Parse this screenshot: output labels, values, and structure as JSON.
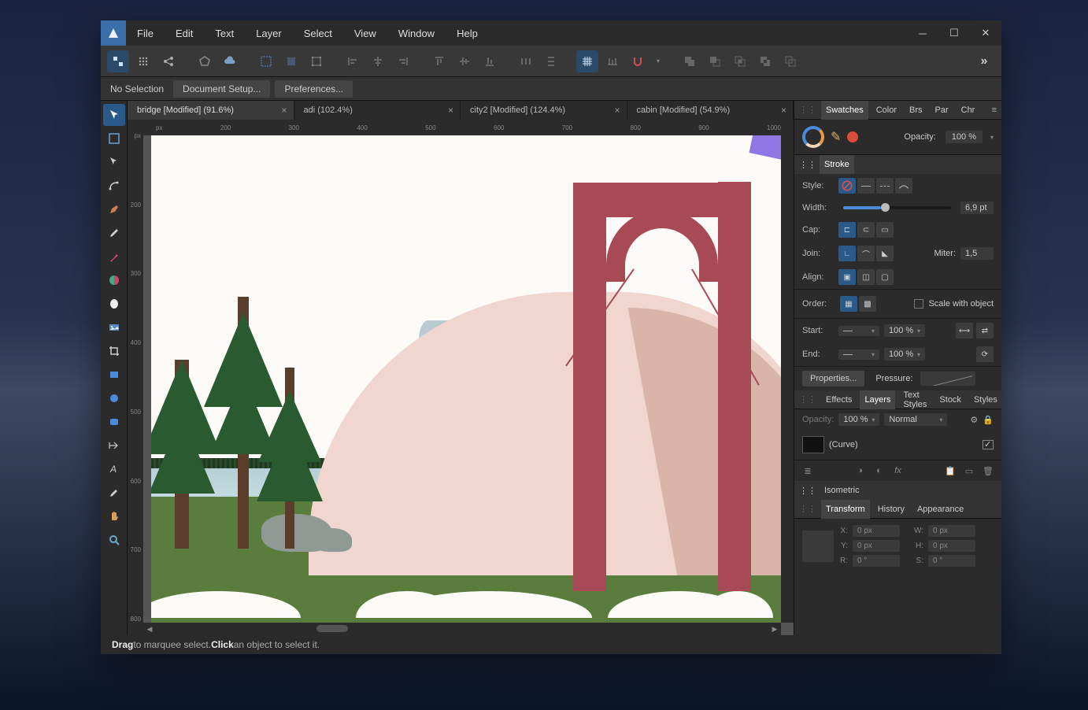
{
  "menu": {
    "items": [
      "File",
      "Edit",
      "Text",
      "Layer",
      "Select",
      "View",
      "Window",
      "Help"
    ]
  },
  "context": {
    "selection": "No Selection",
    "buttons": [
      "Document Setup...",
      "Preferences..."
    ]
  },
  "tabs": [
    {
      "label": "bridge [Modified] (91.6%)",
      "active": true
    },
    {
      "label": "adi (102.4%)",
      "active": false
    },
    {
      "label": "city2 [Modified] (124.4%)",
      "active": false
    },
    {
      "label": "cabin [Modified] (54.9%)",
      "active": false
    }
  ],
  "ruler_h": [
    "px",
    "200",
    "300",
    "400",
    "500",
    "600",
    "700",
    "800",
    "900",
    "1000"
  ],
  "ruler_v": [
    "px",
    "200",
    "300",
    "400",
    "500",
    "600",
    "700",
    "800"
  ],
  "right": {
    "top_tabs": [
      "Swatches",
      "Color",
      "Brs",
      "Par",
      "Chr"
    ],
    "opacity_label": "Opacity:",
    "opacity_value": "100 %",
    "stroke_tab": "Stroke",
    "style_label": "Style:",
    "width_label": "Width:",
    "width_value": "6,9 pt",
    "cap_label": "Cap:",
    "join_label": "Join:",
    "miter_label": "Miter:",
    "miter_value": "1,5",
    "align_label": "Align:",
    "order_label": "Order:",
    "scale_label": "Scale with object",
    "start_label": "Start:",
    "end_label": "End:",
    "pct_value": "100 %",
    "properties_btn": "Properties...",
    "pressure_label": "Pressure:",
    "mid_tabs": [
      "Effects",
      "Layers",
      "Text Styles",
      "Stock",
      "Styles"
    ],
    "lay_opacity_lbl": "Opacity:",
    "lay_opacity": "100 %",
    "lay_blend": "Normal",
    "layer_name": "(Curve)",
    "iso_tab": "Isometric",
    "bot_tabs": [
      "Transform",
      "History",
      "Appearance"
    ],
    "transform": {
      "xl": "X:",
      "x": "0 px",
      "wl": "W:",
      "w": "0 px",
      "yl": "Y:",
      "y": "0 px",
      "hl": "H:",
      "h": "0 px",
      "rl": "R:",
      "r": "0 °",
      "sl": "S:",
      "s": "0 °"
    }
  },
  "status": {
    "a": "Drag",
    "b": " to marquee select. ",
    "c": "Click",
    "d": " an object to select it."
  }
}
